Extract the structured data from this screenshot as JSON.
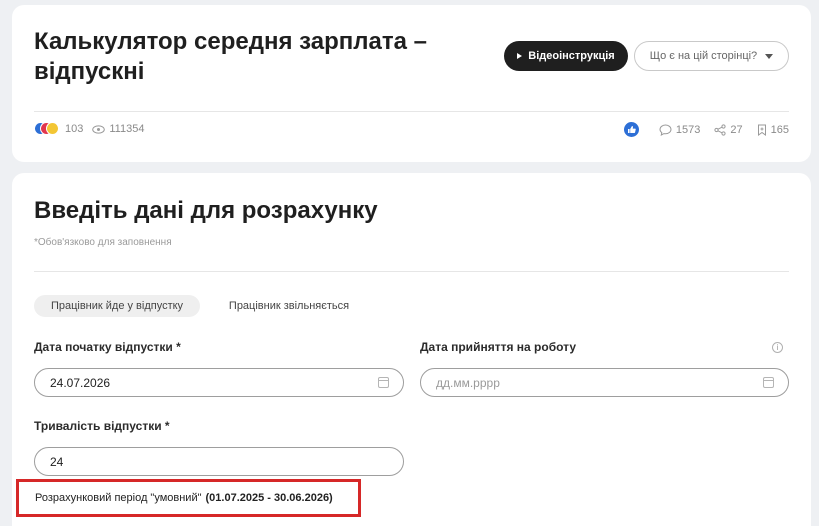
{
  "header": {
    "title": "Калькулятор середня зарплата – відпускні",
    "video_button": "Відеоінструкція",
    "help_button": "Що є на цій сторінці?",
    "reactions_count": "103",
    "views_count": "111354",
    "comments_count": "1573",
    "shares_count": "27",
    "bookmarks_count": "165"
  },
  "form": {
    "title": "Введіть дані для розрахунку",
    "required_note": "*Обов'язково для заповнення",
    "tabs": [
      {
        "label": "Працівник йде у відпустку",
        "active": true
      },
      {
        "label": "Працівник звільняється",
        "active": false
      }
    ],
    "vacation_start": {
      "label": "Дата початку відпустки *",
      "value": "24.07.2026"
    },
    "hire_date": {
      "label": "Дата прийняття на роботу",
      "placeholder": "дд.мм.рррр"
    },
    "duration": {
      "label": "Тривалість відпустки *",
      "value": "24"
    },
    "period": {
      "label": "Розрахунковий період \"умовний\"",
      "range": "(01.07.2025 - 30.06.2026)"
    }
  },
  "colors": {
    "accent_dark": "#1f1f1f",
    "highlight_border": "#d62828",
    "like_blue": "#2d6fd6"
  }
}
